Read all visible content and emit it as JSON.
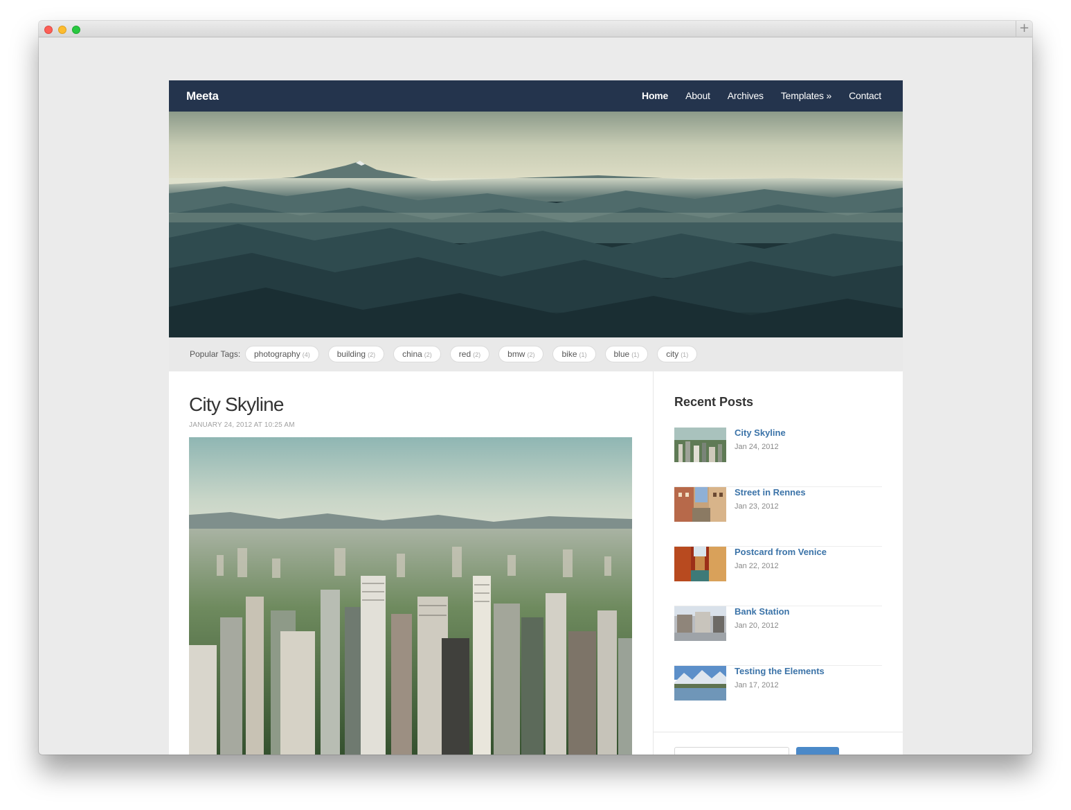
{
  "browser": {
    "new_tab_icon": "+"
  },
  "site": {
    "brand": "Meeta",
    "nav": [
      {
        "label": "Home",
        "active": true
      },
      {
        "label": "About"
      },
      {
        "label": "Archives"
      },
      {
        "label": "Templates »"
      },
      {
        "label": "Contact"
      }
    ]
  },
  "tags": {
    "label": "Popular Tags:",
    "items": [
      {
        "name": "photography",
        "count": "(4)"
      },
      {
        "name": "building",
        "count": "(2)"
      },
      {
        "name": "china",
        "count": "(2)"
      },
      {
        "name": "red",
        "count": "(2)"
      },
      {
        "name": "bmw",
        "count": "(2)"
      },
      {
        "name": "bike",
        "count": "(1)"
      },
      {
        "name": "blue",
        "count": "(1)"
      },
      {
        "name": "city",
        "count": "(1)"
      }
    ]
  },
  "post": {
    "title": "City Skyline",
    "date": "January 24, 2012 at 10:25 AM"
  },
  "sidebar": {
    "title": "Recent Posts",
    "posts": [
      {
        "title": "City Skyline",
        "date": "Jan 24, 2012"
      },
      {
        "title": "Street in Rennes",
        "date": "Jan 23, 2012"
      },
      {
        "title": "Postcard from Venice",
        "date": "Jan 22, 2012"
      },
      {
        "title": "Bank Station",
        "date": "Jan 20, 2012"
      },
      {
        "title": "Testing the Elements",
        "date": "Jan 17, 2012"
      }
    ],
    "search_button": ""
  },
  "colors": {
    "navbar": "#24344d",
    "link": "#3b73a8",
    "button": "#4b89c8"
  }
}
